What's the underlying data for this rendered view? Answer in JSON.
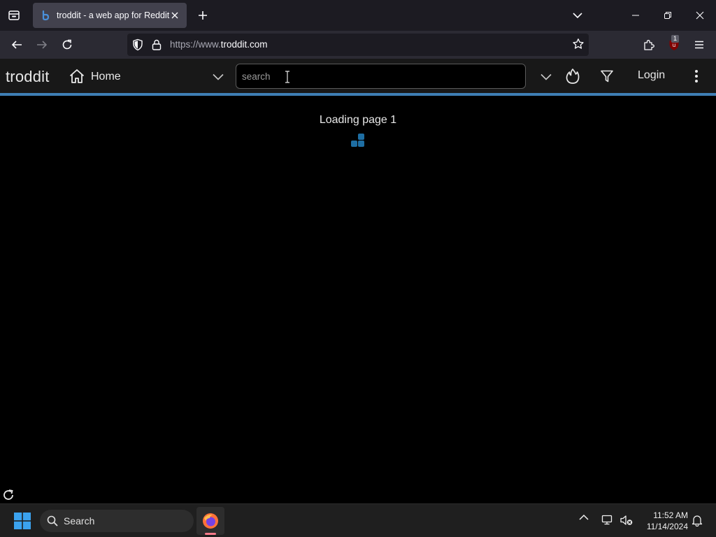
{
  "browser": {
    "tab_title": "troddit - a web app for Reddit",
    "url_scheme": "https://www.",
    "url_host": "troddit.com",
    "extension_badge": "1"
  },
  "app": {
    "brand": "troddit",
    "feed_label": "Home",
    "search_placeholder": "search",
    "login_label": "Login",
    "loading_text": "Loading page 1",
    "accent_color": "#3f7fb5",
    "loader_color": "#1e6ea3"
  },
  "taskbar": {
    "search_label": "Search",
    "time": "11:52 AM",
    "date": "11/14/2024"
  }
}
